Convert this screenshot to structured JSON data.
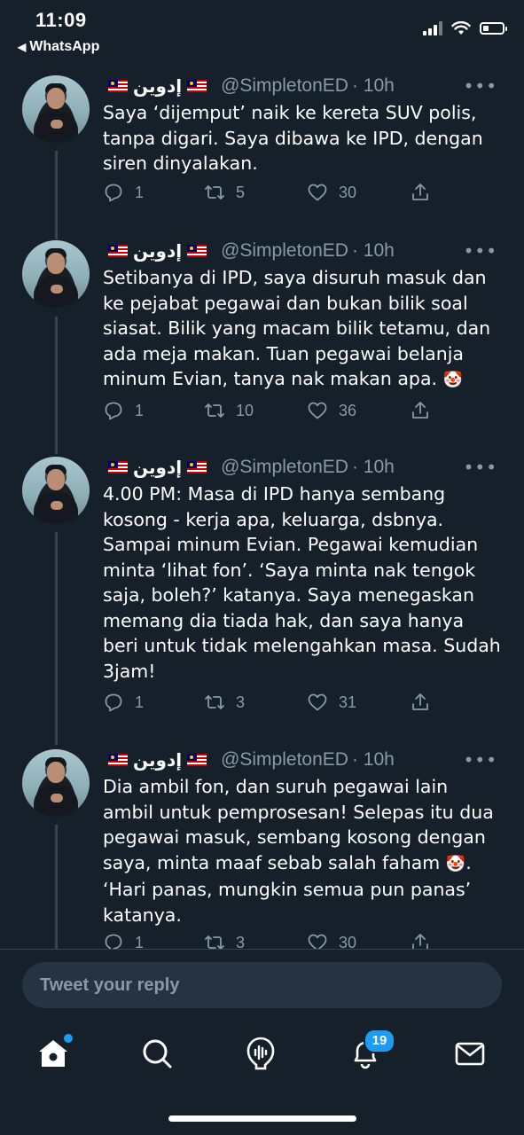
{
  "status_bar": {
    "time": "11:09",
    "back_app": "WhatsApp",
    "battery_level": 0.3
  },
  "tweets": [
    {
      "name": "إدوين",
      "handle": "@SimpletonED",
      "time": "· 10h",
      "text": "Saya ‘dijemput’ naik ke kereta SUV polis, tanpa digari. Saya dibawa ke IPD, dengan siren dinyalakan.",
      "replies": "1",
      "retweets": "5",
      "likes": "30"
    },
    {
      "name": "إدوين",
      "handle": "@SimpletonED",
      "time": "· 10h",
      "text": "Setibanya di IPD, saya disuruh masuk dan ke pejabat pegawai dan bukan bilik soal siasat. Bilik yang macam bilik tetamu, dan ada meja makan. Tuan pegawai belanja minum Evian, tanya nak makan apa.",
      "replies": "1",
      "retweets": "10",
      "likes": "36"
    },
    {
      "name": "إدوين",
      "handle": "@SimpletonED",
      "time": "· 10h",
      "text": "4.00 PM: Masa di IPD hanya sembang kosong - kerja apa, keluarga, dsbnya. Sampai minum Evian. Pegawai kemudian minta ‘lihat fon’. ‘Saya minta nak tengok saja, boleh?’ katanya. Saya menegaskan memang dia tiada hak, dan saya hanya beri untuk tidak melengahkan masa. Sudah 3jam!",
      "replies": "1",
      "retweets": "3",
      "likes": "31"
    },
    {
      "name": "إدوين",
      "handle": "@SimpletonED",
      "time": "· 10h",
      "text_a": "Dia ambil fon, dan suruh pegawai lain ambil untuk pemprosesan! Selepas itu dua pegawai masuk, sembang kosong dengan saya, minta maaf sebab salah faham",
      "text_b": ". ‘Hari panas, mungkin semua pun panas’ katanya.",
      "replies": "1",
      "retweets": "3",
      "likes": "30"
    }
  ],
  "reply": {
    "placeholder": "Tweet your reply"
  },
  "tabbar": {
    "notifications_badge": "19"
  },
  "icons": [
    "home-icon",
    "search-icon",
    "spaces-icon",
    "notifications-icon",
    "messages-icon",
    "reply-icon",
    "retweet-icon",
    "like-icon",
    "share-icon",
    "more-icon",
    "clown-emoji"
  ],
  "colors": {
    "background": "#15202b",
    "muted": "#8b98a5",
    "accent": "#1d9bf0"
  }
}
